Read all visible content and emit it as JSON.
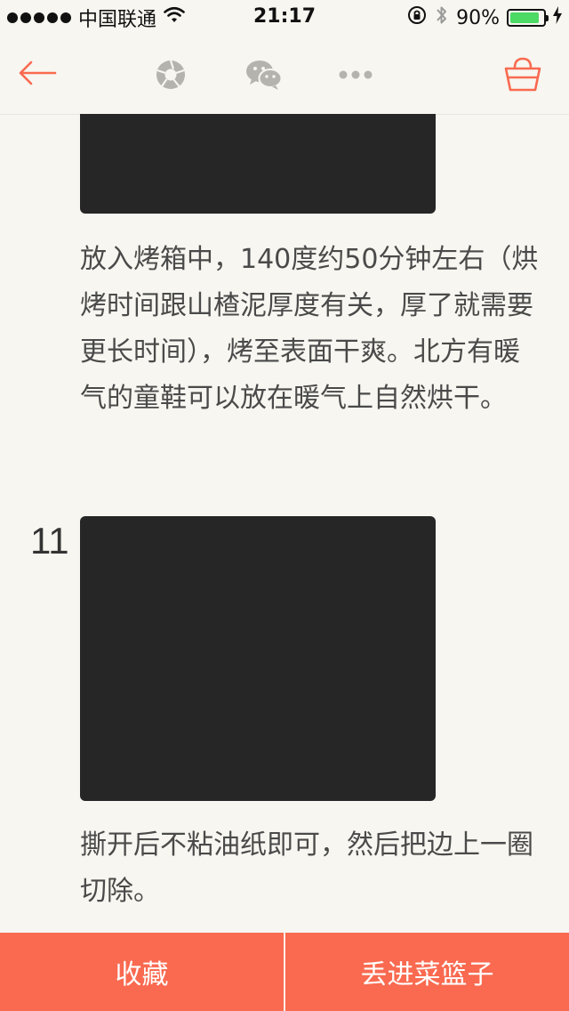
{
  "status_bar": {
    "carrier": "中国联通",
    "time": "21:17",
    "battery_percent": "90%",
    "battery_level": 0.9
  },
  "nav": {
    "icons": [
      "back-arrow-icon",
      "camera-aperture-icon",
      "wechat-icon",
      "more-icon",
      "basket-icon"
    ],
    "accent_color": "#f96a50"
  },
  "steps": [
    {
      "text": "放入烤箱中，140度约50分钟左右（烘烤时间跟山楂泥厚度有关，厚了就需要更长时间），烤至表面干爽。北方有暖气的童鞋可以放在暖气上自然烘干。"
    },
    {
      "number": "11",
      "text": "撕开后不粘油纸即可，然后把边上一圈切除。"
    }
  ],
  "bottom_bar": {
    "favorite_label": "收藏",
    "add_to_basket_label": "丢进菜篮子"
  }
}
